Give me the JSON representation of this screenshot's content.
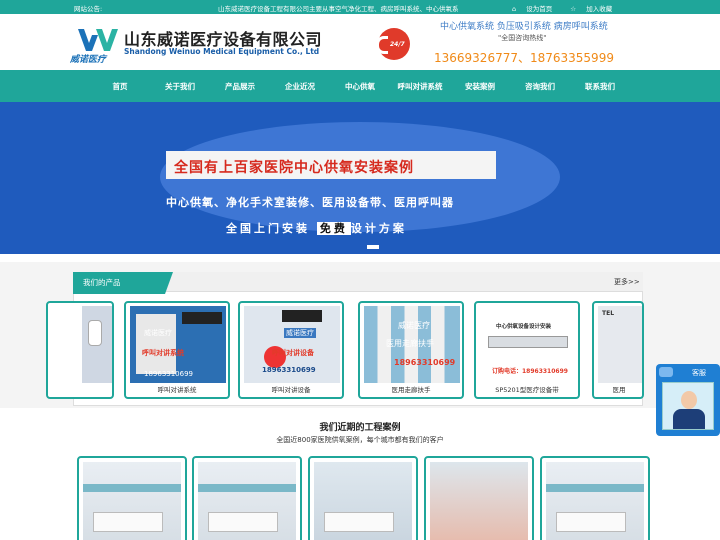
{
  "topbar": {
    "notice_label": "网站公告:",
    "notice_text": "山东威诺医疗设备工程有限公司主要从事空气净化工程、病房呼叫系统、中心供氧系",
    "set_home": "设为首页",
    "bookmark": "加入收藏"
  },
  "header": {
    "logo_mark_text": "威诺医疗",
    "company_cn": "山东威诺医疗设备有限公司",
    "company_en": "Shandong Weinuo Medical Equipment Co., Ltd",
    "badge_text": "24/7",
    "services": "中心供氧系统  负压吸引系统  病房呼叫系统",
    "hotline_label": "\"全国咨询热线\"",
    "phones": "13669326777、18763355999"
  },
  "nav": {
    "items": [
      "首页",
      "关于我们",
      "产品展示",
      "企业近况",
      "中心供氧",
      "呼叫对讲系统",
      "安装案例",
      "咨询我们",
      "联系我们"
    ]
  },
  "banner": {
    "headline": "全国有上百家医院中心供氧安装案例",
    "sub1": "中心供氧、净化手术室装修、医用设备带、医用呼叫器",
    "sub2_a": "全国上门安装",
    "sub2_b": "免费",
    "sub2_c": "设计方案"
  },
  "products": {
    "tab_label": "我们的产品",
    "more_label": "更多>>",
    "items": [
      {
        "caption": ""
      },
      {
        "caption": "呼叫对讲系统",
        "overlay": [
          "威诺医疗",
          "呼叫对讲系统",
          "18963310699"
        ]
      },
      {
        "caption": "呼叫对讲设备",
        "overlay": [
          "威诺医疗",
          "呼叫对讲设备",
          "18963310699"
        ]
      },
      {
        "caption": "医用走廊扶手",
        "overlay": [
          "威诺医疗",
          "医用走廊扶手",
          "18963310699"
        ]
      },
      {
        "caption": "SP5201型医疗设备带",
        "overlay": [
          "中心供氧设备设计安装",
          "订购电话：18963310699"
        ]
      },
      {
        "caption": "医用"
      }
    ]
  },
  "customer_service": {
    "label": "客服"
  },
  "cases": {
    "title": "我们近期的工程案例",
    "subtitle": "全国近800家医院供氧案例，每个城市都有我们的客户"
  },
  "colors": {
    "teal": "#1fa69a",
    "banner_blue": "#1f5bbd",
    "phone_orange": "#f08a18",
    "alert_red": "#d62a1e"
  }
}
